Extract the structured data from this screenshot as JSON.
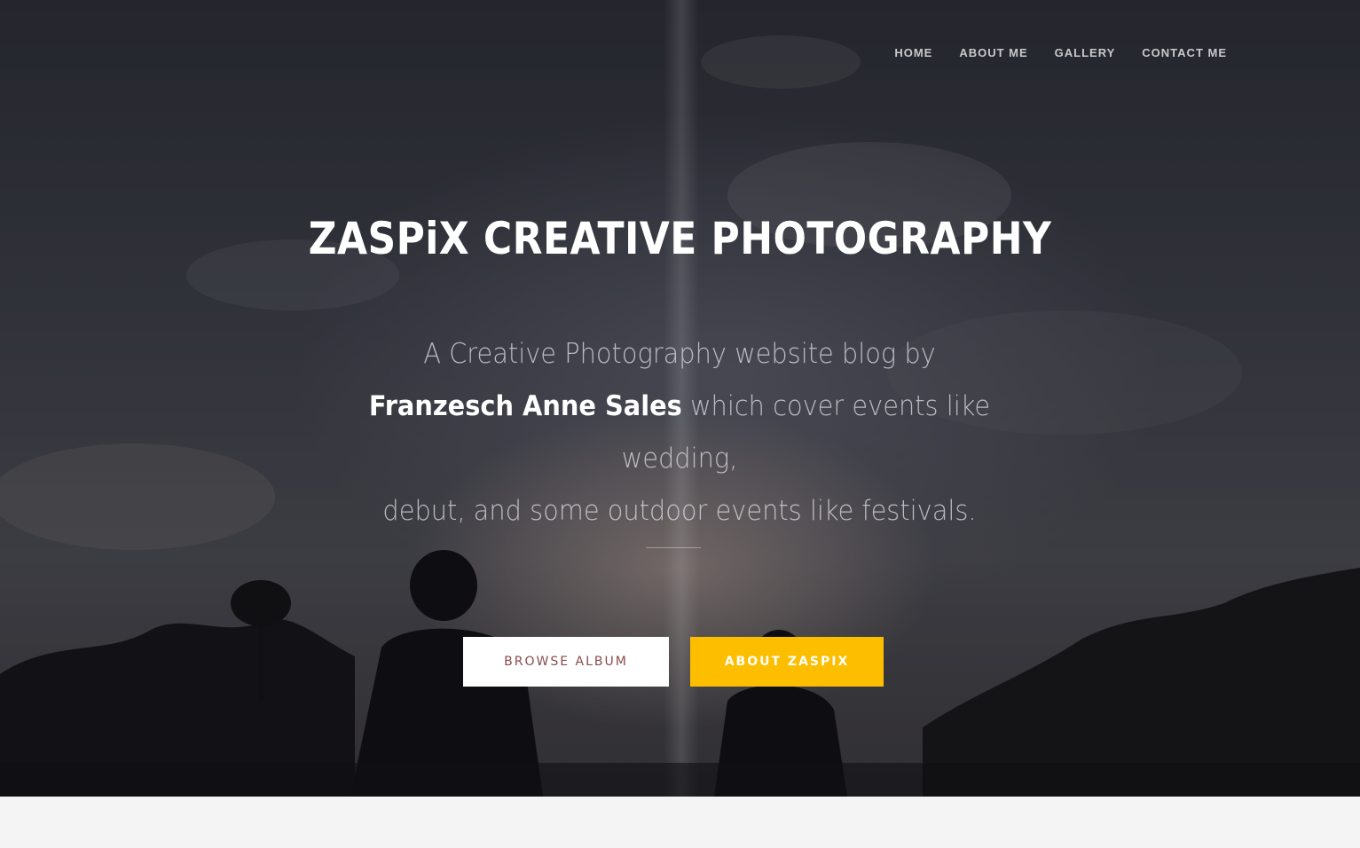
{
  "nav": {
    "items": [
      {
        "label": "HOME"
      },
      {
        "label": "ABOUT ME"
      },
      {
        "label": "GALLERY"
      },
      {
        "label": "CONTACT ME"
      }
    ]
  },
  "hero": {
    "title": "ZASPiX CREATIVE PHOTOGRAPHY",
    "subtitle_line1": "A Creative Photography website blog by",
    "subtitle_name": "Franzesch Anne Sales",
    "subtitle_line2_rest": " which cover events like wedding,",
    "subtitle_line3": "debut, and some outdoor events like festivals."
  },
  "buttons": {
    "browse_label": "BROWSE ALBUM",
    "about_label": "ABOUT ZASPIX"
  },
  "colors": {
    "accent": "#fdbe00",
    "browse_text": "#8a4b4b"
  }
}
